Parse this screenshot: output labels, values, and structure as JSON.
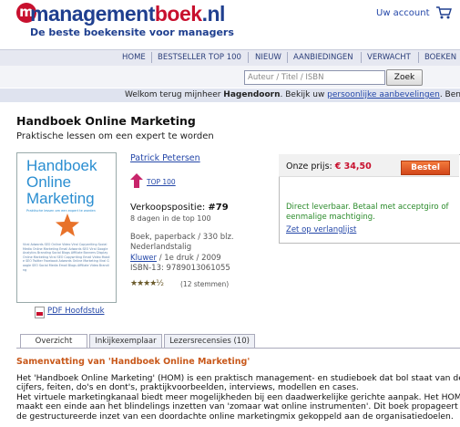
{
  "header": {
    "logo_mark": "m",
    "logo_parts": [
      "management",
      "boek",
      ".nl"
    ],
    "tagline": "De beste boekensite voor managers",
    "account_label": "Uw account",
    "cart_icon": "shopping-cart-icon"
  },
  "nav": {
    "items": [
      "HOME",
      "BESTSELLER TOP 100",
      "NIEUW",
      "AANBIEDINGEN",
      "VERWACHT",
      "BOEKEN"
    ]
  },
  "search": {
    "placeholder": "Auteur / Titel / ISBN",
    "button_label": "Zoek"
  },
  "welcome": {
    "prefix": "Welkom terug mijnheer ",
    "name": "Hagendoorn",
    "middle": ".  Bekijk uw ",
    "link": "persoonlijke aanbevelingen",
    "suffix": ".   Bent u"
  },
  "book": {
    "title": "Handboek Online Marketing",
    "subtitle": "Praktische lessen om een expert te worden",
    "cover": {
      "title_line1": "Handboek",
      "title_line2": "Online",
      "title_line3": "Marketing",
      "subtitle": "Praktische lessen om een expert te worden",
      "cloud_text": "Viral Adwords SEO Online Video Viral Copywriting Social Media Online Marketing Email Adwords SEO Viral Google Analytics Branding Social Blogs Affiliate Banners Display Online Marketing Viral SEO Copywriting Email Video Mobile SEO Twitter Facebook Adwords Online Marketing Viral Google SEO Social Media Email Blogs Affiliate Video Branding"
    },
    "pdf_label": "PDF Hoofdstuk",
    "author": "Patrick Petersen",
    "top100_label": "TOP 100",
    "rank_label": "Verkoopspositie: ",
    "rank_value": "#79",
    "rank_days": "8 dagen in de top 100",
    "meta_line1": "Boek, paperback / 330 blz.",
    "meta_line2": "Nederlandstalig",
    "publisher": "Kluwer",
    "meta_line3_suffix": " / 1e druk / 2009",
    "isbn": "ISBN-13: 9789013061055",
    "stars": "★★★★½",
    "votes": "(12 stemmen)",
    "rating": 4.5
  },
  "price_box": {
    "label": "Onze prijs: ",
    "price": "€ 34,50",
    "buy_label": "Bestel",
    "stock_text": "Direct leverbaar. Betaal met acceptgiro of eenmalige machtiging.",
    "wishlist_label": "Zet op verlanglijst"
  },
  "tabs": [
    "Overzicht",
    "Inkijkexemplaar",
    "Lezersrecensies (10)"
  ],
  "summary": {
    "title": "Samenvatting van 'Handboek Online Marketing'",
    "lines": [
      "Het 'Handboek Online Marketing' (HOM) is een praktisch management- en studieboek dat bol staat van de",
      "cijfers, feiten, do's en dont's, praktijkvoorbeelden, interviews, modellen en cases.",
      "Het virtuele marketingkanaal biedt meer mogelijkheden bij een daadwerkelijke gerichte aanpak. Het HOM",
      "maakt een einde aan het blindelings inzetten van 'zomaar wat online instrumenten'. Dit boek propageert",
      "de gestructureerde inzet van een doordachte online marketingmix gekoppeld aan de organisatiedoelen."
    ]
  }
}
